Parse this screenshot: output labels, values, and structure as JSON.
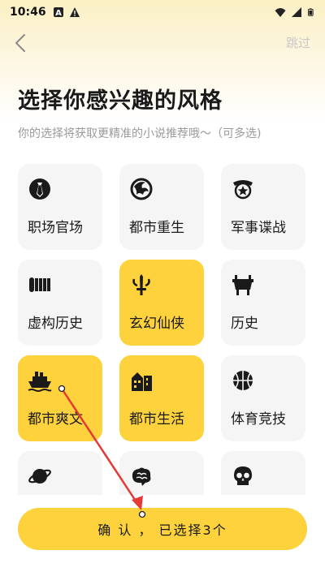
{
  "status_bar": {
    "time": "10:46",
    "left_icons": [
      "keyboard-a-icon",
      "warning-icon"
    ],
    "right_icons": [
      "wifi-icon",
      "cellular-icon",
      "battery-icon"
    ]
  },
  "header": {
    "back_icon": "chevron-left-icon",
    "skip_label": "跳过"
  },
  "title": "选择你感兴趣的风格",
  "subtitle": "你的选择将获取更精准的小说推荐哦～（可多选)",
  "genres": [
    {
      "label": "职场官场",
      "icon": "tie-icon",
      "selected": false
    },
    {
      "label": "都市重生",
      "icon": "phoenix-icon",
      "selected": false
    },
    {
      "label": "军事谍战",
      "icon": "military-badge-icon",
      "selected": false
    },
    {
      "label": "虚构历史",
      "icon": "bamboo-scroll-icon",
      "selected": false
    },
    {
      "label": "玄幻仙侠",
      "icon": "sword-icon",
      "selected": true
    },
    {
      "label": "历史",
      "icon": "bronze-ding-icon",
      "selected": false
    },
    {
      "label": "都市爽文",
      "icon": "ship-icon",
      "selected": true
    },
    {
      "label": "都市生活",
      "icon": "city-buildings-icon",
      "selected": true
    },
    {
      "label": "体育竞技",
      "icon": "basketball-icon",
      "selected": false
    },
    {
      "label": "",
      "icon": "planet-icon",
      "selected": false
    },
    {
      "label": "",
      "icon": "brain-icon",
      "selected": false
    },
    {
      "label": "",
      "icon": "skull-icon",
      "selected": false
    }
  ],
  "confirm_button": {
    "label": "确 认 ， 已选择3个"
  },
  "colors": {
    "accent": "#fdd23c",
    "card_bg": "#f5f5f6",
    "arrow": "#e53935"
  }
}
